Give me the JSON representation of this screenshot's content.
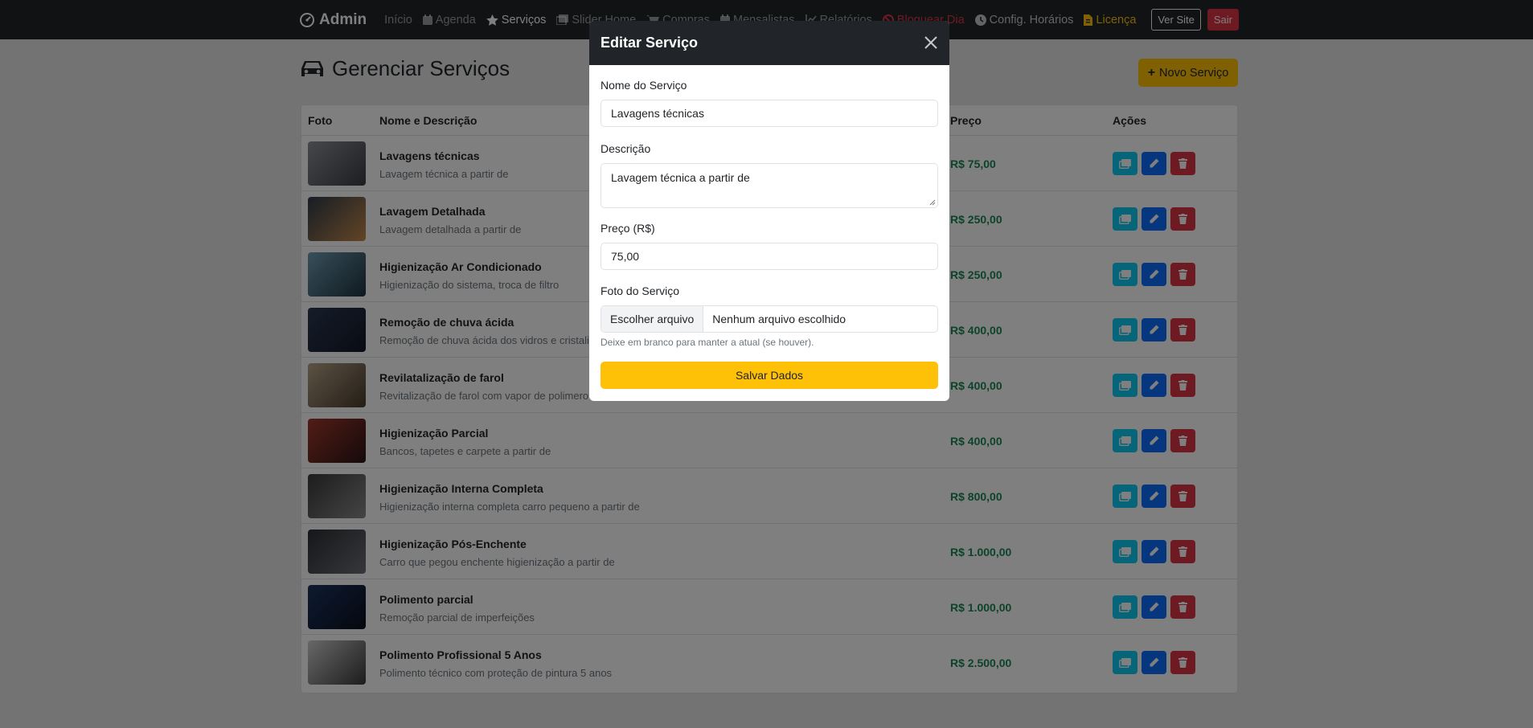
{
  "navbar": {
    "brand": "Admin",
    "links": [
      {
        "label": "Início",
        "icon": "home"
      },
      {
        "label": "Agenda",
        "icon": "calendar-icon"
      },
      {
        "label": "Serviços",
        "icon": "star-icon"
      },
      {
        "label": "Slider Home",
        "icon": "images-icon"
      },
      {
        "label": "Compras",
        "icon": "cart-icon"
      },
      {
        "label": "Mensalistas",
        "icon": "calendar-icon"
      },
      {
        "label": "Relatórios",
        "icon": "chart-icon"
      },
      {
        "label": "Bloquear Dia",
        "icon": "ban-icon"
      },
      {
        "label": "Config. Horários",
        "icon": "clock-icon"
      },
      {
        "label": "Licença",
        "icon": "file-icon"
      }
    ],
    "view_site": "Ver Site",
    "logout": "Sair"
  },
  "page": {
    "title": "Gerenciar Serviços",
    "new_button": "Novo Serviço"
  },
  "table": {
    "headers": {
      "photo": "Foto",
      "name": "Nome e Descrição",
      "price": "Preço",
      "actions": "Ações"
    },
    "rows": [
      {
        "name": "Lavagens técnicas",
        "desc": "Lavagem técnica a partir de",
        "price": "R$ 75,00"
      },
      {
        "name": "Lavagem Detalhada",
        "desc": "Lavagem detalhada a partir de",
        "price": "R$ 250,00"
      },
      {
        "name": "Higienização Ar Condicionado",
        "desc": "Higienização do sistema, troca de filtro",
        "price": "R$ 250,00"
      },
      {
        "name": "Remoção de chuva ácida",
        "desc": "Remoção de chuva ácida dos vidros e cristalização",
        "price": "R$ 400,00"
      },
      {
        "name": "Revilatalização de farol",
        "desc": "Revitalização de farol com vapor de polimero",
        "price": "R$ 400,00"
      },
      {
        "name": "Higienização Parcial",
        "desc": "Bancos, tapetes e carpete a partir de",
        "price": "R$ 400,00"
      },
      {
        "name": "Higienização Interna Completa",
        "desc": "Higienização interna completa carro pequeno a partir de",
        "price": "R$ 800,00"
      },
      {
        "name": "Higienização Pós-Enchente",
        "desc": "Carro que pegou enchente higienização a partir de",
        "price": "R$ 1.000,00"
      },
      {
        "name": "Polimento parcial",
        "desc": "Remoção parcial de imperfeições",
        "price": "R$ 1.000,00"
      },
      {
        "name": "Polimento Profissional 5 Anos",
        "desc": "Polimento técnico com proteção de pintura 5 anos",
        "price": "R$ 2.500,00"
      }
    ]
  },
  "modal": {
    "title": "Editar Serviço",
    "name_label": "Nome do Serviço",
    "name_value": "Lavagens técnicas",
    "desc_label": "Descrição",
    "desc_value": "Lavagem técnica a partir de",
    "price_label": "Preço (R$)",
    "price_value": "75,00",
    "photo_label": "Foto do Serviço",
    "file_button": "Escolher arquivo",
    "file_status": "Nenhum arquivo escolhido",
    "photo_help": "Deixe em branco para manter a atual (se houver).",
    "save_button": "Salvar Dados"
  },
  "colors": {
    "navbar": "#212529",
    "accent": "#ffc107",
    "success": "#198754",
    "info": "#0dcaf0",
    "primary": "#0d6efd",
    "danger": "#dc3545"
  }
}
